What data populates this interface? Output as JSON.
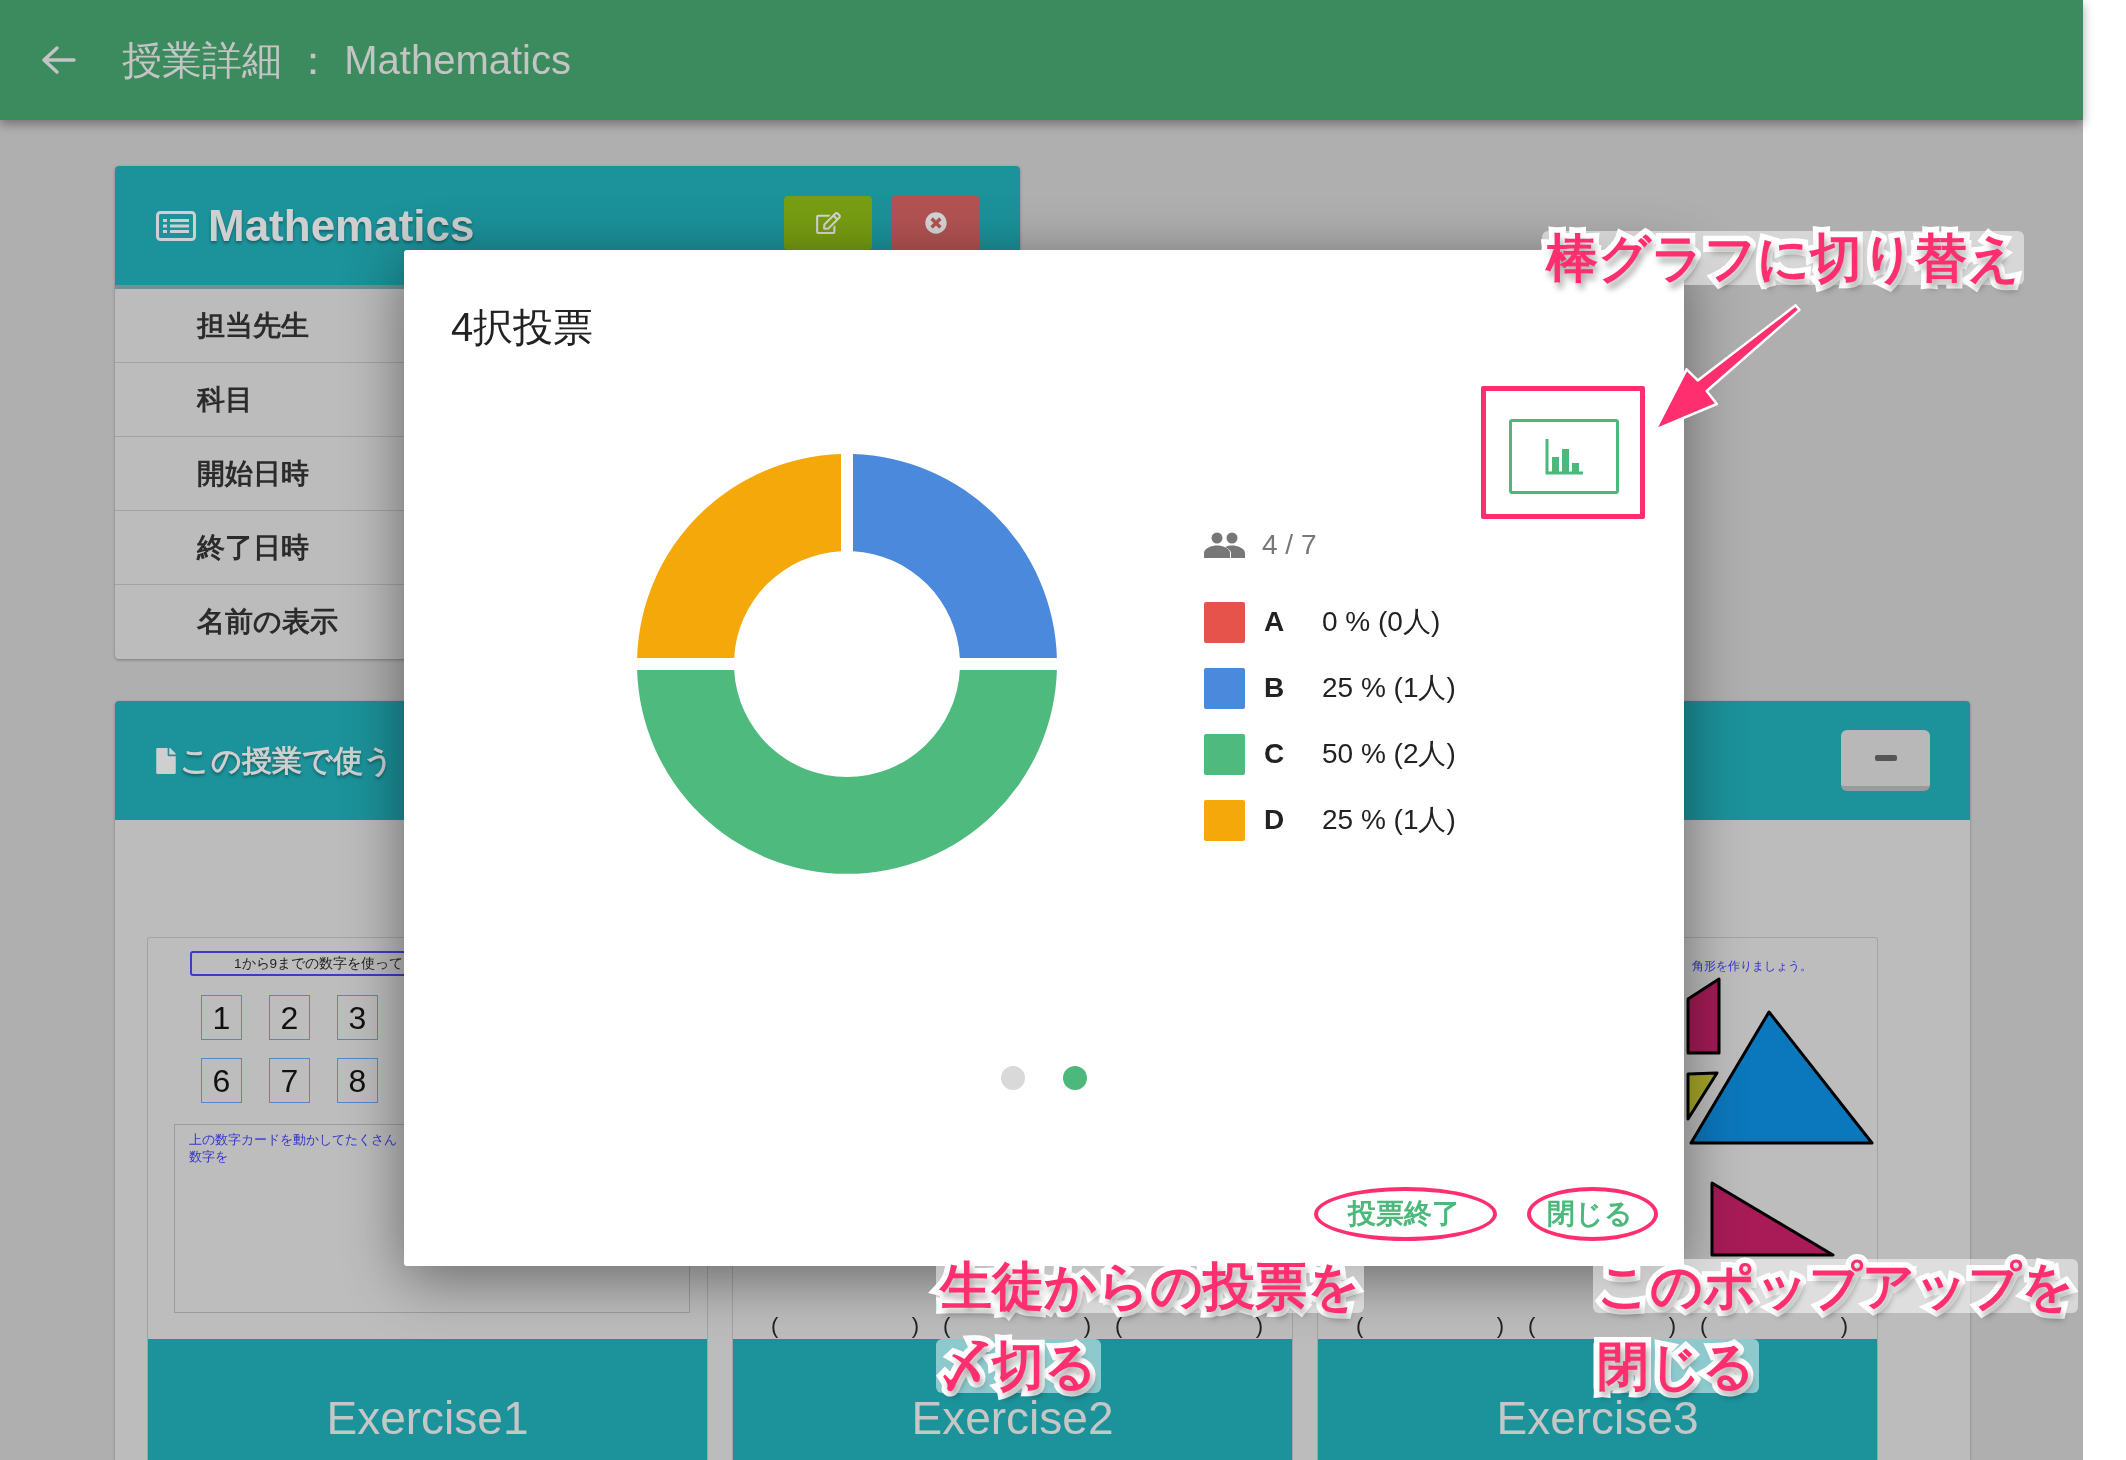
{
  "app_bar": {
    "title": "授業詳細 ： Mathematics"
  },
  "class_card": {
    "title": "Mathematics",
    "rows": [
      "担当先生",
      "科目",
      "開始日時",
      "終了日時",
      "名前の表示"
    ]
  },
  "materials_card": {
    "title": "この授業で使う",
    "expanded": true,
    "exercises": [
      {
        "kind": "number_cards",
        "title": "Exercise1",
        "prompt": "1から9までの数字を使って",
        "cards": [
          "1",
          "2",
          "3",
          "6",
          "7",
          "8"
        ],
        "answer_text": "上の数字カードを動かしてたくさん数字を"
      },
      {
        "kind": "blanks",
        "title": "Exercise2",
        "blanks": [
          {
            "open": "(",
            "close": ")"
          },
          {
            "open": "(",
            "close": ")"
          },
          {
            "open": "(",
            "close": ")"
          }
        ]
      },
      {
        "kind": "shapes",
        "title": "Exercise3",
        "instruction": "角形を作りましょう。",
        "blanks": [
          {
            "open": "(",
            "close": ")"
          },
          {
            "open": "(",
            "close": ")"
          },
          {
            "open": "(",
            "close": ")"
          }
        ]
      }
    ]
  },
  "poll_dialog": {
    "title": "4択投票",
    "responses": "4 / 7",
    "chart_data": {
      "type": "donut",
      "categories": [
        "A",
        "B",
        "C",
        "D"
      ],
      "values": [
        0,
        25,
        50,
        25
      ]
    },
    "legend": [
      {
        "value": "0 % (0人)",
        "color": "#e5534b"
      },
      {
        "value": "25 % (1人)",
        "color": "#4a89dc"
      },
      {
        "value": "50 % (2人)",
        "color": "#4fba7e"
      },
      {
        "value": "25 % (1人)",
        "color": "#f4a80a"
      }
    ],
    "pager": [
      {
        "selected": false
      },
      {
        "selected": true
      }
    ],
    "actions": [
      "投票終了",
      "閉じる"
    ]
  },
  "annotations": [
    {
      "kind": "chart_switch",
      "lines": [
        "棒グラフに切り替え"
      ]
    },
    {
      "kind": "end_vote",
      "lines": [
        "生徒からの投票を",
        "〆切る"
      ]
    },
    {
      "kind": "close",
      "lines": [
        "このポップアップを",
        "閉じる"
      ]
    }
  ]
}
